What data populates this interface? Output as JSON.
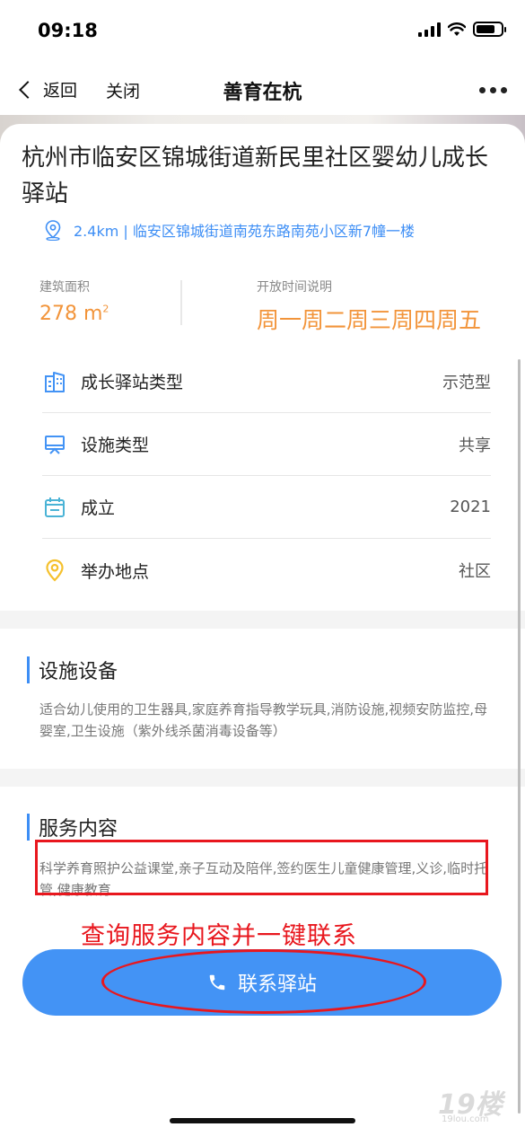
{
  "status": {
    "time": "09:18"
  },
  "nav": {
    "back_label": "返回",
    "close_label": "关闭",
    "title": "善育在杭"
  },
  "station": {
    "name": "杭州市临安区锦城街道新民里社区婴幼儿成长驿站",
    "distance_address": "2.4km | 临安区锦城街道南苑东路南苑小区新7幢一楼"
  },
  "stats": {
    "area_label": "建筑面积",
    "area_value": "278 m",
    "area_unit_sup": "2",
    "hours_label": "开放时间说明",
    "hours_value": "周一周二周三周四周五"
  },
  "info_rows": [
    {
      "label": "成长驿站类型",
      "value": "示范型",
      "icon": "building-icon"
    },
    {
      "label": "设施类型",
      "value": "共享",
      "icon": "monitor-icon"
    },
    {
      "label": "成立",
      "value": "2021",
      "icon": "calendar-icon"
    },
    {
      "label": "举办地点",
      "value": "社区",
      "icon": "location-icon"
    }
  ],
  "facilities": {
    "title": "设施设备",
    "body": "适合幼儿使用的卫生器具,家庭养育指导教学玩具,消防设施,视频安防监控,母婴室,卫生设施（紫外线杀菌消毒设备等）"
  },
  "services": {
    "title": "服务内容",
    "body": "科学养育照护公益课堂,亲子互动及陪伴,签约医生儿童健康管理,义诊,临时托管,健康教育"
  },
  "annotation": {
    "text": "查询服务内容并一键联系"
  },
  "contact_button": {
    "label": "联系驿站"
  },
  "watermark": {
    "main": "19楼",
    "sub": "19lou.com"
  },
  "colors": {
    "accent": "#4393f5",
    "orange": "#f2943a",
    "annotation_red": "#e8171e"
  }
}
